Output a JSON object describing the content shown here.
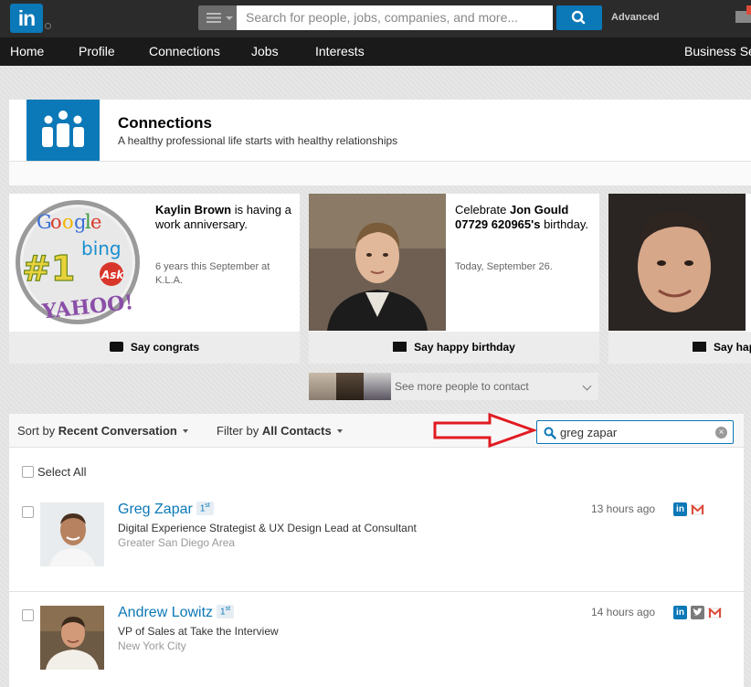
{
  "header": {
    "logo_text": "in",
    "search_placeholder": "Search for people, jobs, companies, and more...",
    "advanced_label": "Advanced"
  },
  "nav": {
    "items": [
      "Home",
      "Profile",
      "Connections",
      "Jobs",
      "Interests",
      "Business Se"
    ]
  },
  "page": {
    "title": "Connections",
    "subtitle": "A healthy professional life starts with healthy relationships"
  },
  "cards": [
    {
      "name": "Kaylin Brown",
      "line_after": " is having a work anniversary.",
      "meta": "6 years this September at K.L.A.",
      "action": "Say congrats"
    },
    {
      "prefix": "Celebrate ",
      "name": "Jon Gould 07729 620965's",
      "line_after": " birthday.",
      "meta": "Today, September 26.",
      "action": "Say happy birthday"
    },
    {
      "action": "Say hap"
    }
  ],
  "see_more": {
    "label": "See more people to contact"
  },
  "list": {
    "sort_prefix": "Sort by ",
    "sort_value": "Recent Conversation",
    "filter_prefix": "Filter by ",
    "filter_value": "All Contacts",
    "search_value": "greg zapar",
    "select_all": "Select All",
    "rows": [
      {
        "name": "Greg Zapar",
        "degree": "1",
        "degree_suffix": "st",
        "title": "Digital Experience Strategist & UX Design Lead at Consultant",
        "location": "Greater San Diego Area",
        "time": "13 hours ago"
      },
      {
        "name": "Andrew Lowitz",
        "degree": "1",
        "degree_suffix": "st",
        "title": "VP of Sales at Take the Interview",
        "location": "New York City",
        "time": "14 hours ago"
      }
    ]
  },
  "colors": {
    "brand_blue": "#0b78b7",
    "topbar": "#2b2b2b",
    "navbar": "#1a1a1a",
    "arrow_red": "#e11b22",
    "gmail_red": "#dd4b39"
  }
}
